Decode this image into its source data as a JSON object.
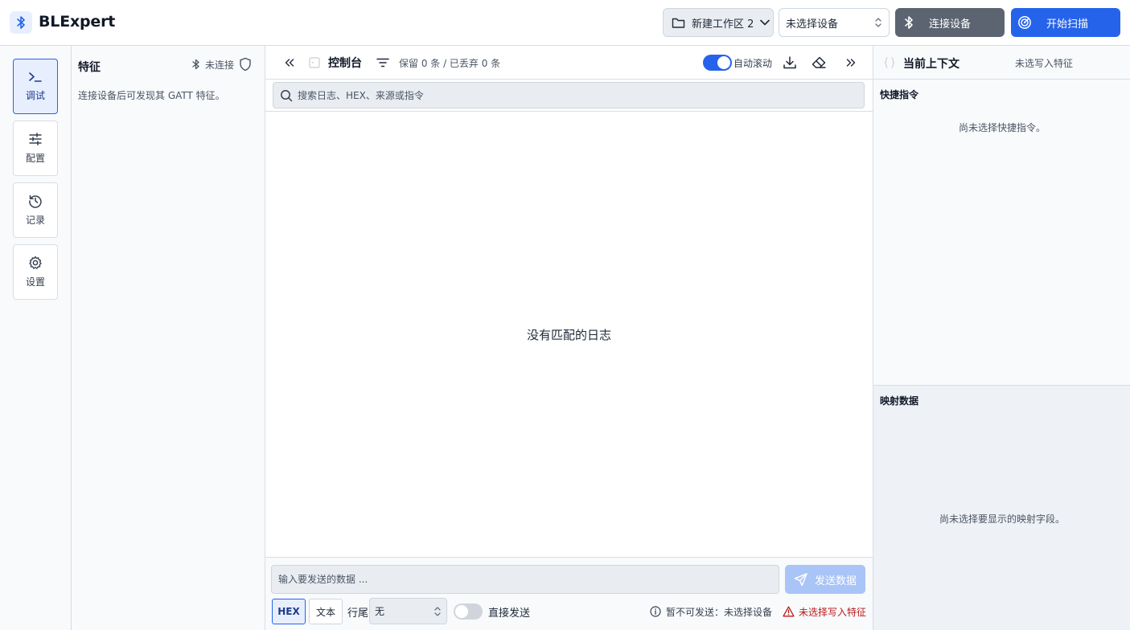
{
  "header": {
    "app_title": "BLExpert",
    "workspace_label": "新建工作区 2",
    "device_select": "未选择设备",
    "connect_label": "连接设备",
    "scan_label": "开始扫描"
  },
  "nav": {
    "items": [
      {
        "label": "调试",
        "icon": "terminal-icon",
        "active": true
      },
      {
        "label": "配置",
        "icon": "sliders-icon",
        "active": false
      },
      {
        "label": "记录",
        "icon": "history-icon",
        "active": false
      },
      {
        "label": "设置",
        "icon": "gear-icon",
        "active": false
      }
    ]
  },
  "characteristics": {
    "title": "特征",
    "status": "未连接",
    "hint": "连接设备后可发现其 GATT 特征。"
  },
  "console": {
    "title": "控制台",
    "stats": "保留 0 条 / 已丢弃 0 条",
    "autoscroll_label": "自动滚动",
    "autoscroll_on": true,
    "search_placeholder": "搜索日志、HEX、来源或指令",
    "empty_text": "没有匹配的日志"
  },
  "sendbar": {
    "input_placeholder": "输入要发送的数据 ...",
    "send_label": "发送数据",
    "mode_hex": "HEX",
    "mode_text": "文本",
    "eol_label": "行尾",
    "eol_value": "无",
    "direct_label": "直接发送",
    "direct_on": false,
    "status_text": "暂不可发送：未选择设备",
    "warn_text": "未选择写入特征"
  },
  "context": {
    "title": "当前上下文",
    "subtitle": "未选写入特征",
    "quick_title": "快捷指令",
    "quick_empty": "尚未选择快捷指令。",
    "mapped_title": "映射数据",
    "mapped_empty": "尚未选择要显示的映射字段。"
  },
  "colors": {
    "accent": "#2563eb",
    "connect_button": "#5b6470",
    "send_disabled": "#a9c4f6",
    "warning": "#b91c1c"
  }
}
